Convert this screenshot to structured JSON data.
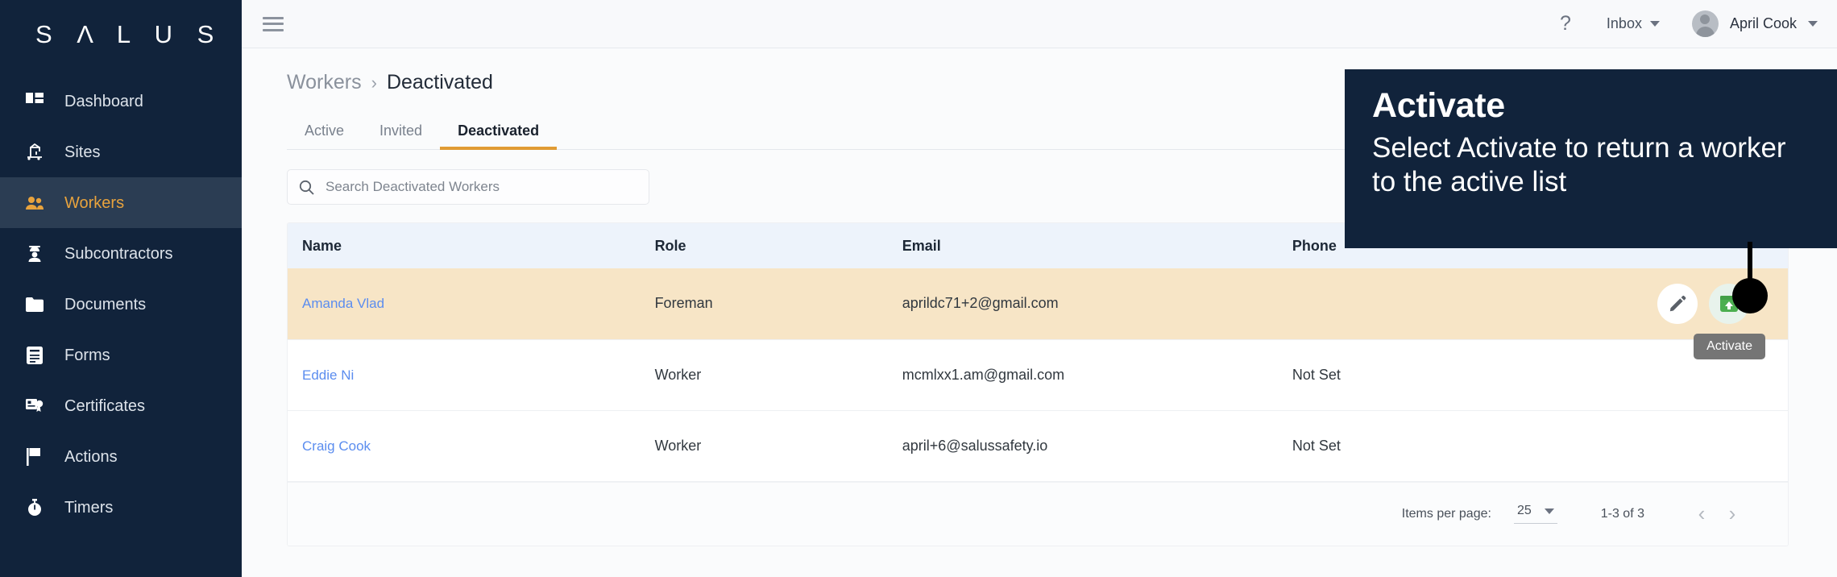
{
  "brand": {
    "name": "S Λ L U S"
  },
  "sidebar": {
    "items": [
      {
        "label": "Dashboard",
        "icon": "dashboard-icon",
        "active": false
      },
      {
        "label": "Sites",
        "icon": "crane-icon",
        "active": false
      },
      {
        "label": "Workers",
        "icon": "workers-icon",
        "active": true
      },
      {
        "label": "Subcontractors",
        "icon": "hardhat-person-icon",
        "active": false
      },
      {
        "label": "Documents",
        "icon": "folder-icon",
        "active": false
      },
      {
        "label": "Forms",
        "icon": "form-icon",
        "active": false
      },
      {
        "label": "Certificates",
        "icon": "certificate-icon",
        "active": false
      },
      {
        "label": "Actions",
        "icon": "flag-icon",
        "active": false
      },
      {
        "label": "Timers",
        "icon": "timer-icon",
        "active": false
      }
    ]
  },
  "topbar": {
    "menu_icon": "hamburger-icon",
    "help_icon": "question-mark-icon",
    "inbox_label": "Inbox",
    "user_name": "April Cook",
    "avatar_icon": "user-avatar-icon"
  },
  "breadcrumb": {
    "parent": "Workers",
    "separator": "›",
    "current": "Deactivated"
  },
  "tabs": [
    {
      "label": "Active",
      "selected": false
    },
    {
      "label": "Invited",
      "selected": false
    },
    {
      "label": "Deactivated",
      "selected": true
    }
  ],
  "search": {
    "placeholder": "Search Deactivated Workers",
    "value": "",
    "icon": "search-icon"
  },
  "table": {
    "columns": [
      "Name",
      "Role",
      "Email",
      "Phone"
    ],
    "rows": [
      {
        "name": "Amanda Vlad",
        "role": "Foreman",
        "email": "aprildc71+2@gmail.com",
        "phone": "",
        "highlighted": true,
        "actions": [
          "edit-icon",
          "activate-icon"
        ]
      },
      {
        "name": "Eddie Ni",
        "role": "Worker",
        "email": "mcmlxx1.am@gmail.com",
        "phone": "Not Set",
        "highlighted": false,
        "actions": []
      },
      {
        "name": "Craig Cook",
        "role": "Worker",
        "email": "april+6@salussafety.io",
        "phone": "Not Set",
        "highlighted": false,
        "actions": []
      }
    ],
    "row_tooltip": "Activate"
  },
  "paginator": {
    "items_per_page_label": "Items per page:",
    "items_per_page_value": "25",
    "range_label": "1-3 of 3",
    "prev_icon": "chevron-left-icon",
    "next_icon": "chevron-right-icon"
  },
  "coach": {
    "title": "Activate",
    "body": "Select Activate to return a worker  to the active list"
  },
  "colors": {
    "sidebar_bg": "#11233b",
    "accent": "#e09b34",
    "active_nav_text": "#e8a33d",
    "row_highlight": "#f7e5c6",
    "table_header_bg": "#edf3fb",
    "link": "#5b8def",
    "activate_green": "#4caf50",
    "tooltip_bg": "#757575"
  }
}
